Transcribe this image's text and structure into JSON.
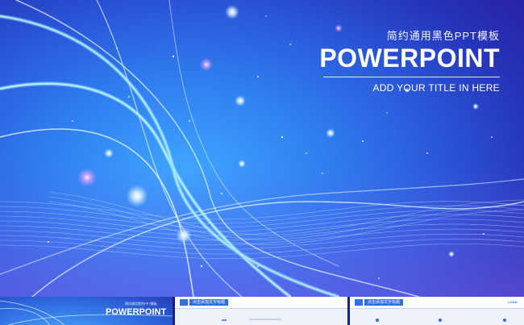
{
  "slide": {
    "subtitle_cn": "简约通用黑色PPT模板",
    "title": "POWERPOINT",
    "tagline": "ADD YOUR TITLE IN HERE"
  },
  "thumbnails": [
    {
      "title": "POWERPOINT",
      "subtitle_cn": "简约通用黑色PPT模板"
    },
    {
      "header": "点击添加文字标题"
    },
    {
      "header": "点击添加文字标题",
      "brand": "LOGO"
    }
  ],
  "colors": {
    "background": "#2a55d8",
    "highlight": "#3fa6ff",
    "text": "#ffffff",
    "thumb_accent": "#2f6ee6"
  }
}
